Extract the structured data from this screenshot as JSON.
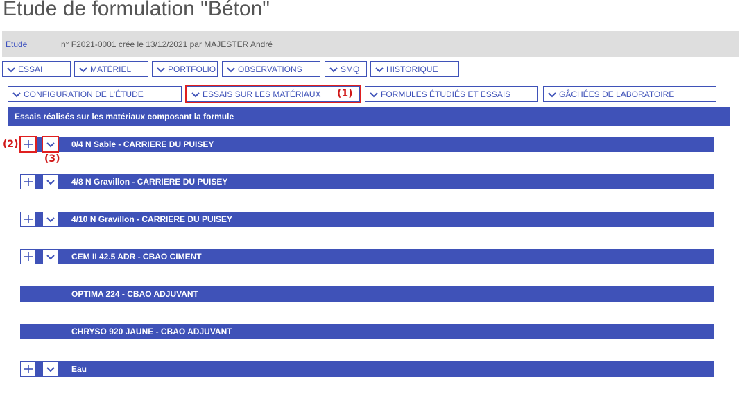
{
  "page": {
    "title": "Etude de formulation \"Béton\""
  },
  "study": {
    "link": "Etude",
    "detail": "n° F2021-0001 crée le 13/12/2021 par MAJESTER André"
  },
  "nav_row1": [
    {
      "label": "ESSAI"
    },
    {
      "label": "MATÉRIEL"
    },
    {
      "label": "PORTFOLIO"
    },
    {
      "label": "OBSERVATIONS"
    },
    {
      "label": "SMQ"
    },
    {
      "label": "HISTORIQUE"
    }
  ],
  "nav_row2": [
    {
      "label": "CONFIGURATION DE L'ÉTUDE"
    },
    {
      "label": "ESSAIS SUR LES MATÉRIAUX"
    },
    {
      "label": "FORMULES ÉTUDIÉS ET ESSAIS"
    },
    {
      "label": "GÂCHÉES DE LABORATOIRE"
    }
  ],
  "section": {
    "title": "Essais réalisés sur les matériaux composant la formule"
  },
  "materials": [
    {
      "label": "0/4 N Sable - CARRIERE DU PUISEY"
    },
    {
      "label": "4/8 N Gravillon - CARRIERE DU PUISEY"
    },
    {
      "label": "4/10 N Gravillon - CARRIERE DU PUISEY"
    },
    {
      "label": "CEM II 42.5 ADR - CBAO CIMENT"
    },
    {
      "label": "OPTIMA 224 - CBAO ADJUVANT"
    },
    {
      "label": "CHRYSO 920 JAUNE - CBAO ADJUVANT"
    },
    {
      "label": "Eau"
    }
  ],
  "annotations": {
    "a1": "(1)",
    "a2": "(2)",
    "a3": "(3)"
  },
  "colors": {
    "primary": "#3f52b8",
    "highlight": "#e02020",
    "info_bg": "#dedede"
  }
}
